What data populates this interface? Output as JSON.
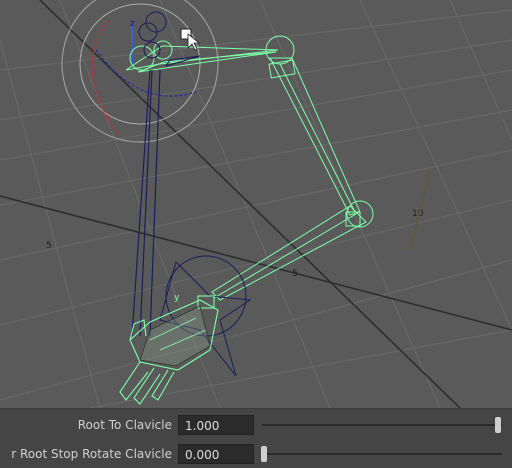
{
  "viewport": {
    "grid_labels": [
      "5",
      "5",
      "10"
    ],
    "axis_labels": {
      "y": "y",
      "z": "z"
    }
  },
  "attributes": [
    {
      "label": "Root To Clavicle",
      "value": "1.000",
      "slider_fraction": 0.985
    },
    {
      "label": "Root Stop Rotate Clavicle",
      "label_prefix": "r",
      "value": "0.000",
      "slider_fraction": 0.01
    }
  ],
  "colors": {
    "rig_green": "#7dffa8",
    "bone_navy": "#1a1e5a",
    "viewport_bg": "#5a5a5a",
    "grid_dark": "#2e2e2e"
  }
}
